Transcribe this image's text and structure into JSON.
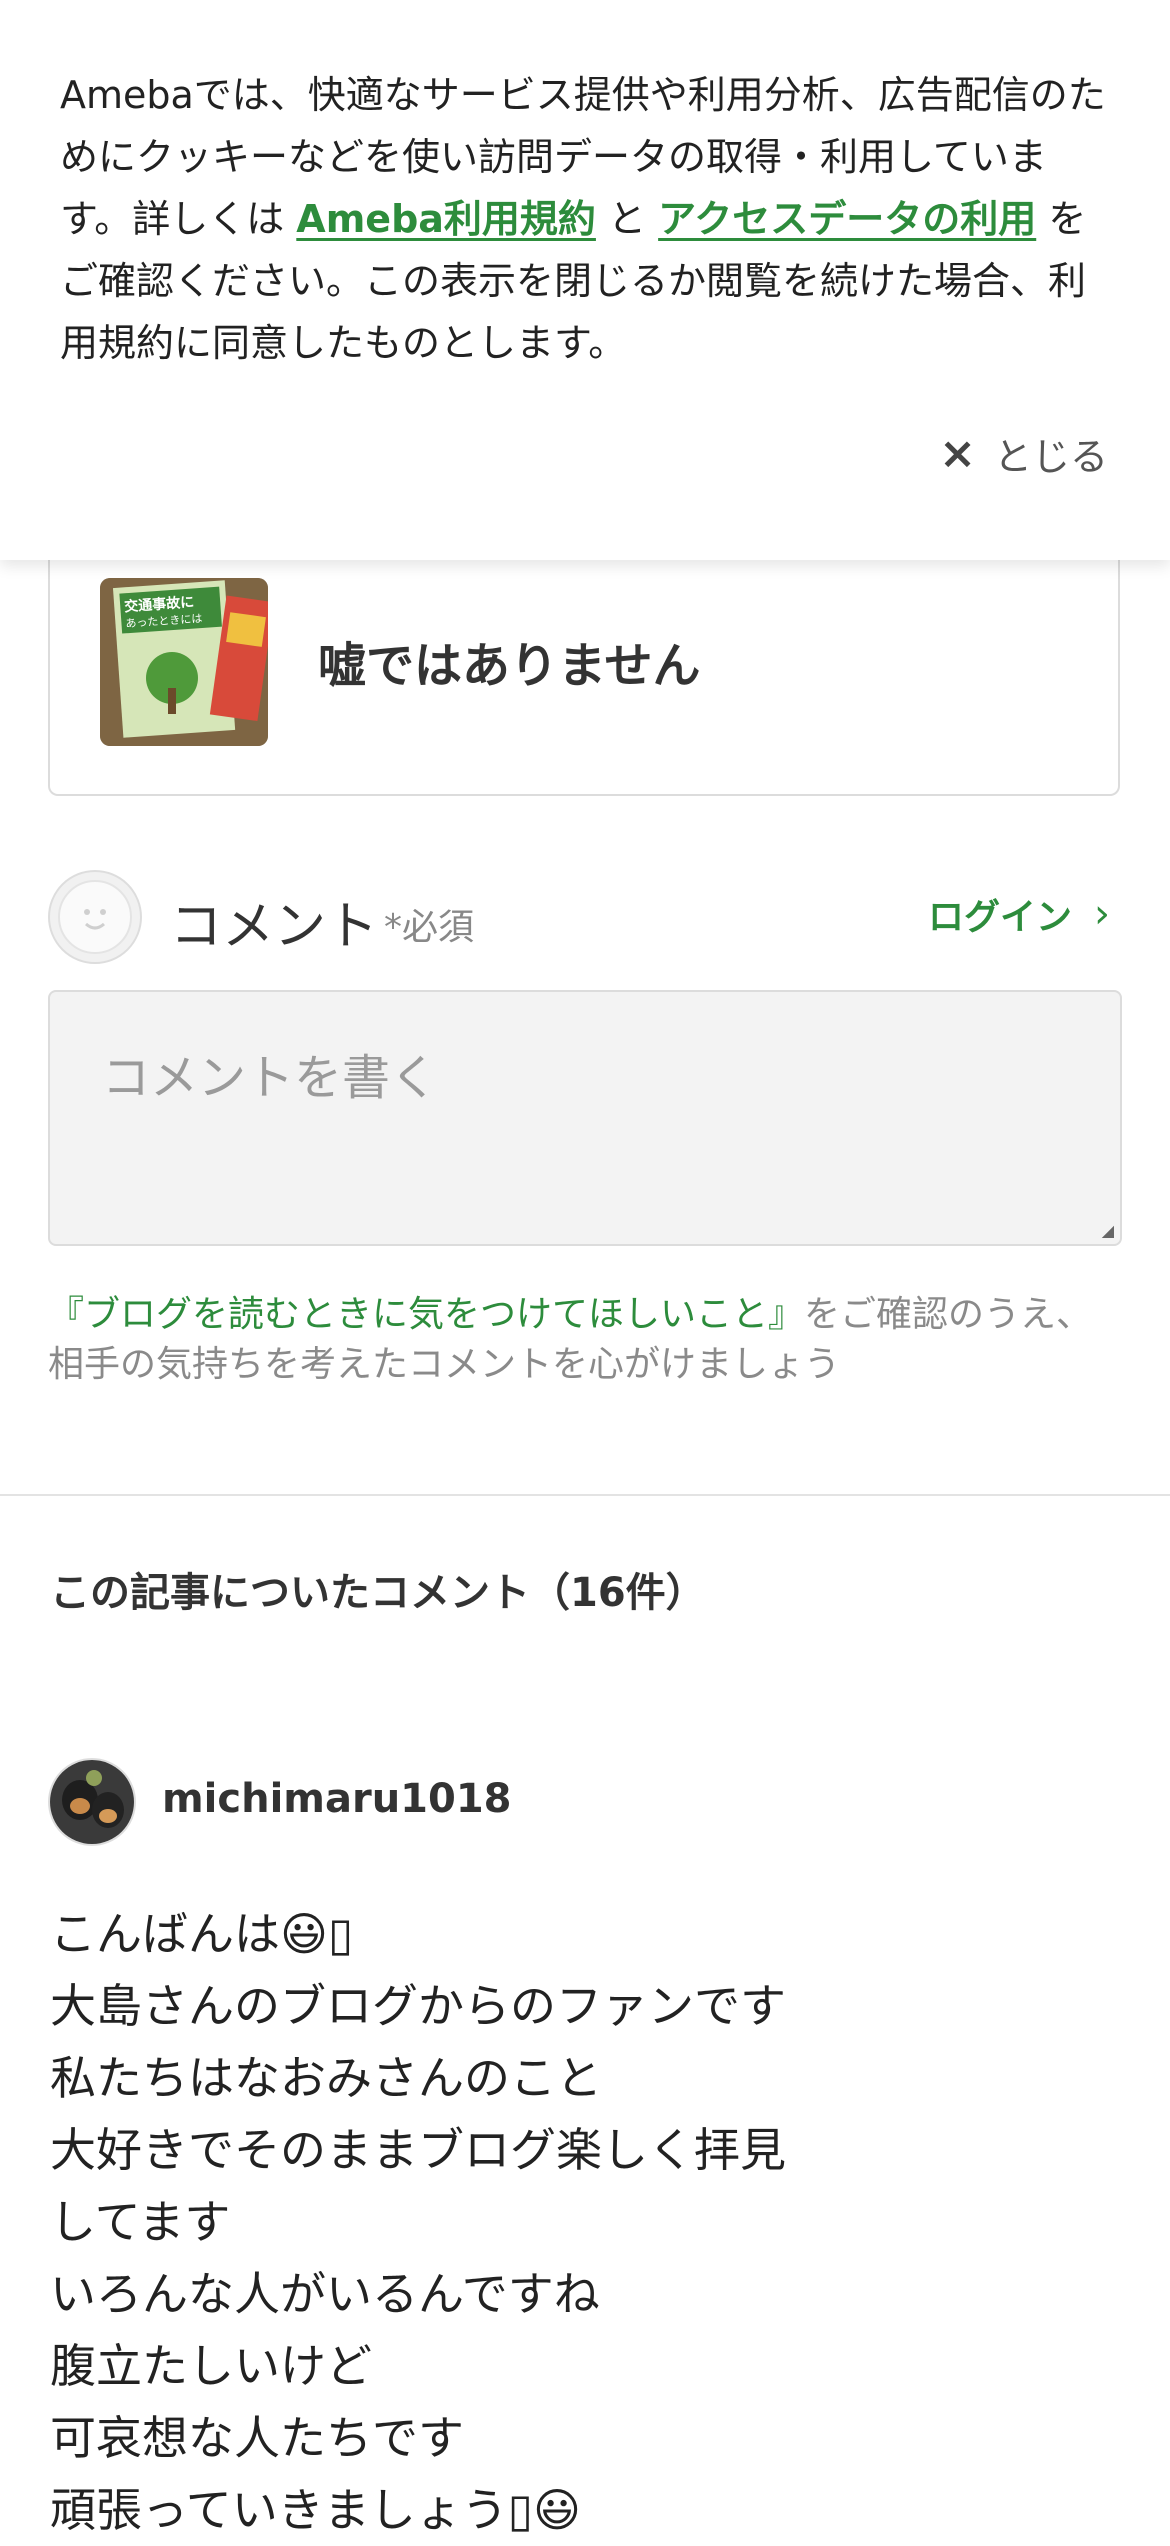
{
  "cookie_banner": {
    "text_1": "Amebaでは、快適なサービス提供や利用分析、広告配信のためにクッキーなどを使い訪問データの取得・利用しています。詳しくは",
    "link_terms": "Ameba利用規約",
    "text_2": "と",
    "link_access": "アクセスデータの利用",
    "text_3": "をご確認ください。この表示を閉じるか閲覧を続けた場合、利用規約に同意したものとします。",
    "close_label": "とじる",
    "close_icon": "×"
  },
  "article_card": {
    "title": "嘘ではありません",
    "thumbnail_text_1": "交通事故に",
    "thumbnail_text_2": "あったときには"
  },
  "comment_form": {
    "label": "コメント",
    "required": "*必須",
    "login_label": "ログイン",
    "login_chevron": "›",
    "placeholder": "コメントを書く",
    "guide_link": "『ブログを読むときに気をつけてほしいこと』",
    "guide_text": "をご確認のうえ、相手の気持ちを考えたコメントを心がけましょう"
  },
  "comments": {
    "heading": "この記事についたコメント（16件）",
    "items": [
      {
        "username": "michimaru1018",
        "lines": [
          "こんばんは😃▯",
          "大島さんのブログからのファンです",
          "私たちはなおみさんのこと",
          "大好きでそのままブログ楽しく拝見",
          "してます",
          "いろんな人がいるんですね",
          "腹立たしいけど",
          "可哀想な人たちです",
          "頑張っていきましょう▯😃"
        ]
      }
    ]
  },
  "colors": {
    "accent_green": "#2d8c3c",
    "text": "#222222",
    "muted": "#8a8a8a"
  }
}
